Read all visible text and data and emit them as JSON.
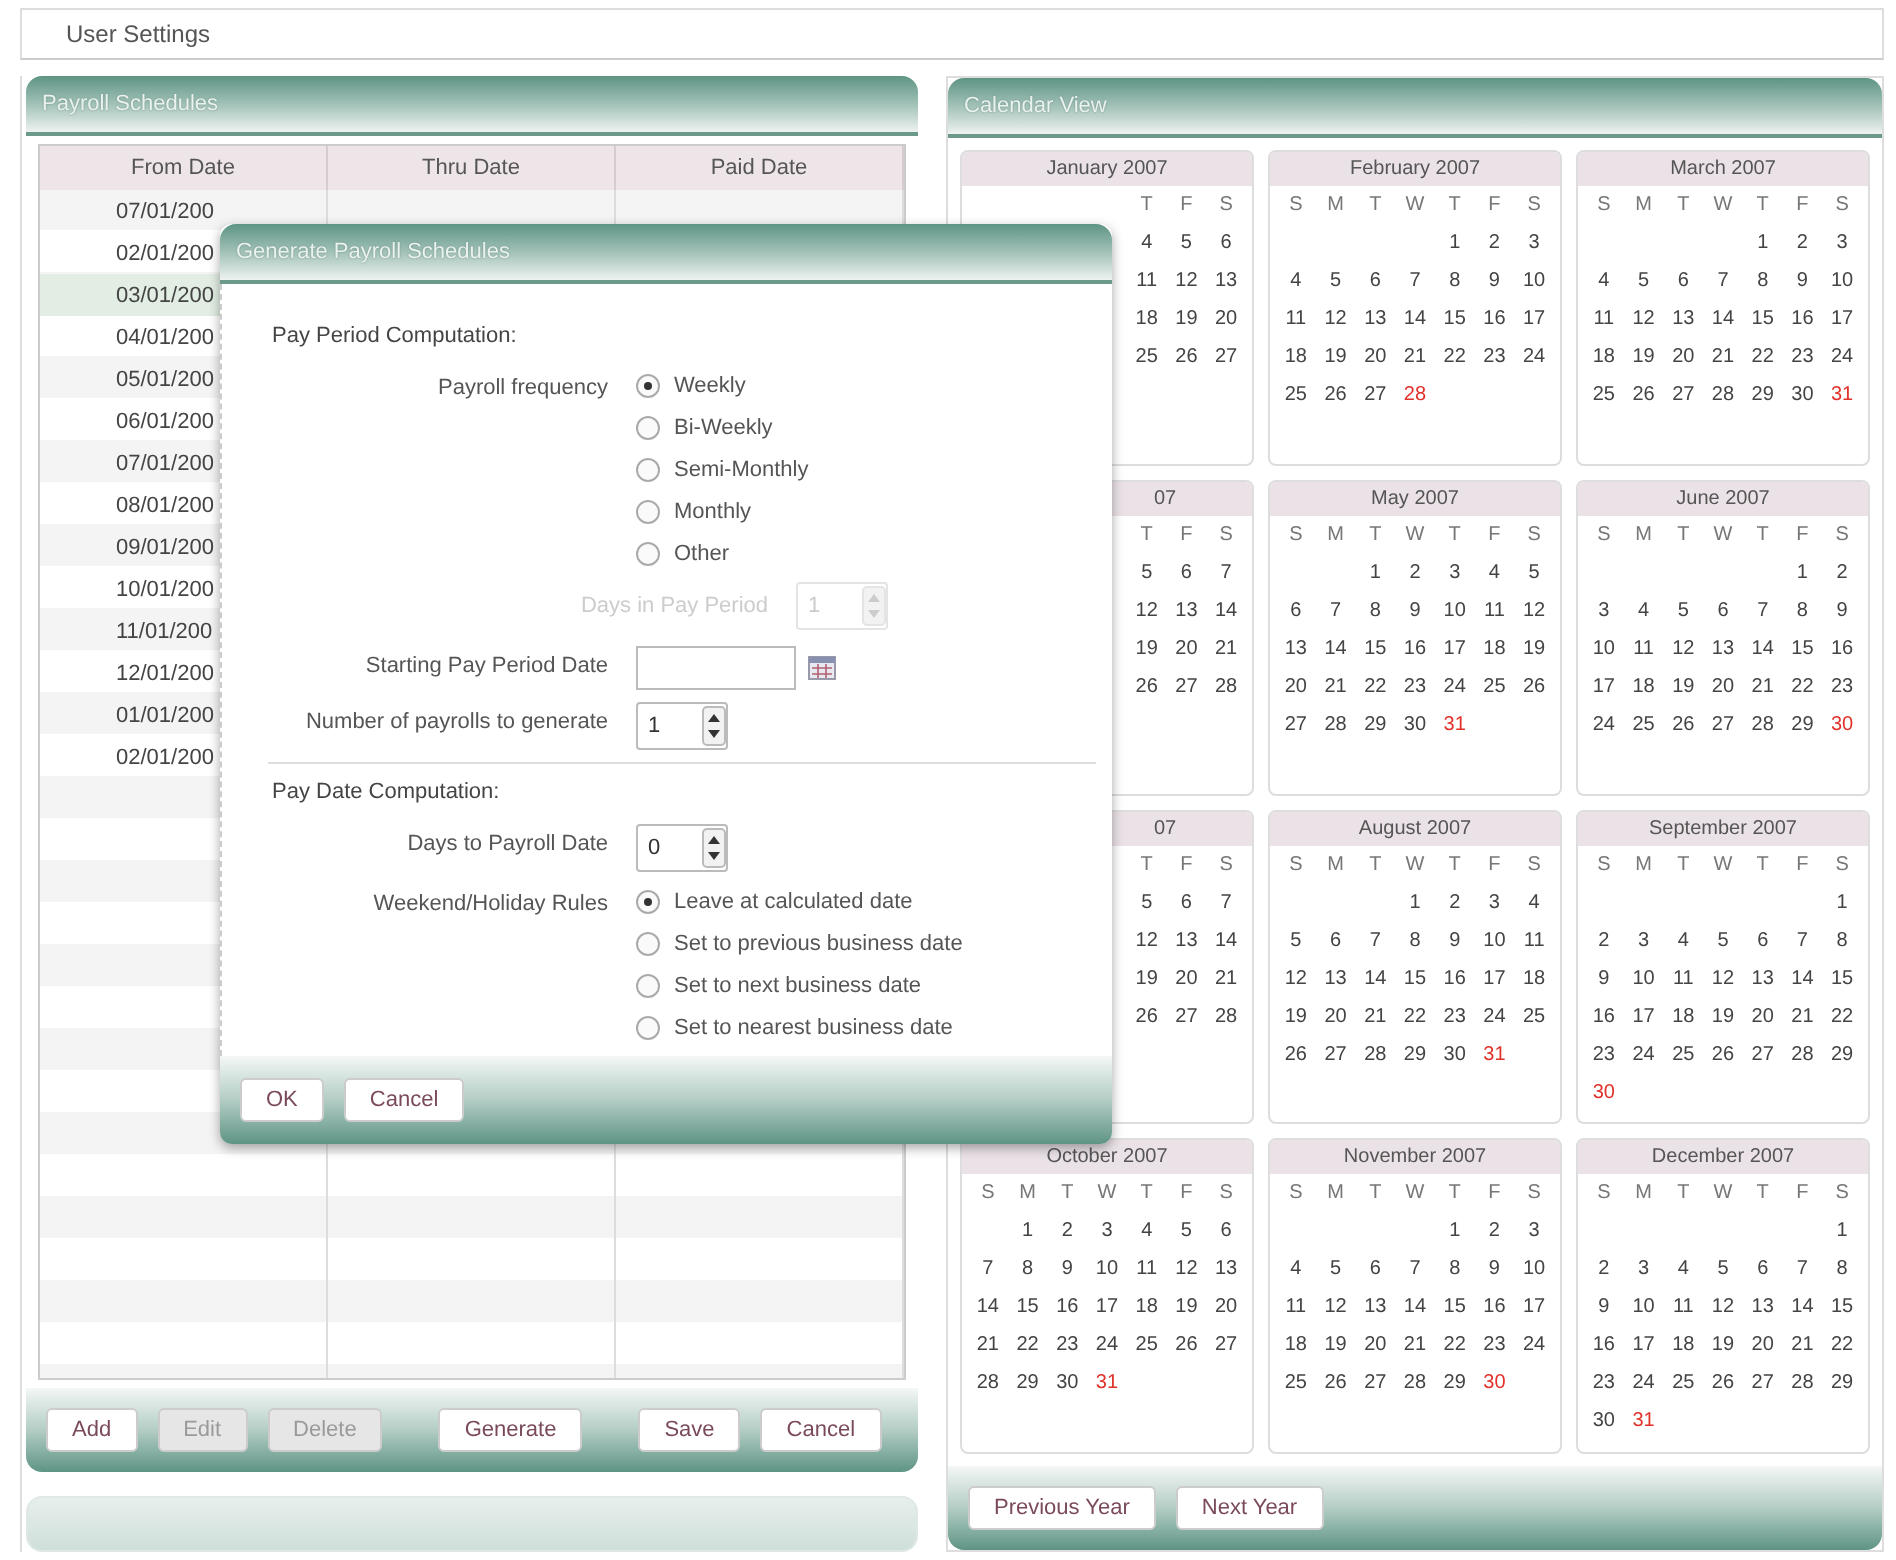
{
  "top_bar": {
    "title": "User Settings"
  },
  "payroll_panel": {
    "title": "Payroll Schedules",
    "columns": [
      "From Date",
      "Thru Date",
      "Paid Date"
    ],
    "rows": [
      {
        "from_date": "07/01/200",
        "selected": false
      },
      {
        "from_date": "02/01/200",
        "selected": false
      },
      {
        "from_date": "03/01/200",
        "selected": true
      },
      {
        "from_date": "04/01/200",
        "selected": false
      },
      {
        "from_date": "05/01/200",
        "selected": false
      },
      {
        "from_date": "06/01/200",
        "selected": false
      },
      {
        "from_date": "07/01/200",
        "selected": false
      },
      {
        "from_date": "08/01/200",
        "selected": false
      },
      {
        "from_date": "09/01/200",
        "selected": false
      },
      {
        "from_date": "10/01/200",
        "selected": false
      },
      {
        "from_date": "11/01/200",
        "selected": false
      },
      {
        "from_date": "12/01/200",
        "selected": false
      },
      {
        "from_date": "01/01/200",
        "selected": false
      },
      {
        "from_date": "02/01/200",
        "selected": false
      }
    ],
    "buttons": [
      {
        "label": "Add",
        "disabled": false
      },
      {
        "label": "Edit",
        "disabled": true
      },
      {
        "label": "Delete",
        "disabled": true
      },
      {
        "label": "Generate",
        "disabled": false
      },
      {
        "label": "Save",
        "disabled": false
      },
      {
        "label": "Cancel",
        "disabled": false
      }
    ]
  },
  "calendar_panel": {
    "title": "Calendar View",
    "months": [
      {
        "title": "January 2007",
        "title_cut": false,
        "kind": "covered",
        "weekdays": [
          "T",
          "F",
          "S"
        ],
        "weeks": [
          {
            "kind": "leading",
            "days": [
              "4",
              "5",
              "6"
            ]
          },
          {
            "kind": "leading",
            "days": [
              "11",
              "12",
              "13"
            ]
          },
          {
            "kind": "leading",
            "days": [
              "18",
              "19",
              "20"
            ]
          },
          {
            "kind": "leading",
            "days": [
              "25",
              "26",
              "27"
            ]
          }
        ]
      },
      {
        "title": "February 2007",
        "title_cut": false,
        "kind": "whole",
        "weekdays": [
          "S",
          "M",
          "T",
          "W",
          "T",
          "F",
          "S"
        ],
        "weeks": [
          {
            "kind": "leading",
            "days": [
              "1",
              "2",
              "3"
            ]
          },
          {
            "kind": "trailing",
            "days": [
              "4",
              "5",
              "6",
              "7",
              "8",
              "9",
              "10"
            ]
          },
          {
            "kind": "trailing",
            "days": [
              "11",
              "12",
              "13",
              "14",
              "15",
              "16",
              "17"
            ]
          },
          {
            "kind": "trailing",
            "days": [
              "18",
              "19",
              "20",
              "21",
              "22",
              "23",
              "24"
            ]
          },
          {
            "kind": "trailing",
            "days": [
              "25",
              "26",
              "27",
              {
                "text": "28",
                "highlighted": true
              }
            ]
          }
        ]
      },
      {
        "title": "March 2007",
        "title_cut": false,
        "kind": "whole",
        "weekdays": [
          "S",
          "M",
          "T",
          "W",
          "T",
          "F",
          "S"
        ],
        "weeks": [
          {
            "kind": "leading",
            "days": [
              "1",
              "2",
              "3"
            ]
          },
          {
            "kind": "trailing",
            "days": [
              "4",
              "5",
              "6",
              "7",
              "8",
              "9",
              "10"
            ]
          },
          {
            "kind": "trailing",
            "days": [
              "11",
              "12",
              "13",
              "14",
              "15",
              "16",
              "17"
            ]
          },
          {
            "kind": "trailing",
            "days": [
              "18",
              "19",
              "20",
              "21",
              "22",
              "23",
              "24"
            ]
          },
          {
            "kind": "trailing",
            "days": [
              "25",
              "26",
              "27",
              "28",
              "29",
              "30",
              {
                "text": "31",
                "highlighted": true
              }
            ]
          }
        ]
      },
      {
        "title": "07",
        "title_cut": true,
        "kind": "covered",
        "weekdays": [
          "T",
          "F",
          "S"
        ],
        "weeks": [
          {
            "kind": "leading",
            "days": [
              "5",
              "6",
              "7"
            ]
          },
          {
            "kind": "leading",
            "days": [
              "12",
              "13",
              "14"
            ]
          },
          {
            "kind": "leading",
            "days": [
              "19",
              "20",
              "21"
            ]
          },
          {
            "kind": "leading",
            "days": [
              "26",
              "27",
              "28"
            ]
          }
        ]
      },
      {
        "title": "May 2007",
        "title_cut": false,
        "kind": "whole",
        "weekdays": [
          "S",
          "M",
          "T",
          "W",
          "T",
          "F",
          "S"
        ],
        "weeks": [
          {
            "kind": "leading",
            "days": [
              "1",
              "2",
              "3",
              "4",
              "5"
            ]
          },
          {
            "kind": "trailing",
            "days": [
              "6",
              "7",
              "8",
              "9",
              "10",
              "11",
              "12"
            ]
          },
          {
            "kind": "trailing",
            "days": [
              "13",
              "14",
              "15",
              "16",
              "17",
              "18",
              "19"
            ]
          },
          {
            "kind": "trailing",
            "days": [
              "20",
              "21",
              "22",
              "23",
              "24",
              "25",
              "26"
            ]
          },
          {
            "kind": "trailing",
            "days": [
              "27",
              "28",
              "29",
              "30",
              {
                "text": "31",
                "highlighted": true
              }
            ]
          }
        ]
      },
      {
        "title": "June 2007",
        "title_cut": false,
        "kind": "whole",
        "weekdays": [
          "S",
          "M",
          "T",
          "W",
          "T",
          "F",
          "S"
        ],
        "weeks": [
          {
            "kind": "leading",
            "days": [
              "1",
              "2"
            ]
          },
          {
            "kind": "trailing",
            "days": [
              "3",
              "4",
              "5",
              "6",
              "7",
              "8",
              "9"
            ]
          },
          {
            "kind": "trailing",
            "days": [
              "10",
              "11",
              "12",
              "13",
              "14",
              "15",
              "16"
            ]
          },
          {
            "kind": "trailing",
            "days": [
              "17",
              "18",
              "19",
              "20",
              "21",
              "22",
              "23"
            ]
          },
          {
            "kind": "trailing",
            "days": [
              "24",
              "25",
              "26",
              "27",
              "28",
              "29",
              {
                "text": "30",
                "highlighted": true
              }
            ]
          }
        ]
      },
      {
        "title": "07",
        "title_cut": true,
        "kind": "covered",
        "weekdays": [
          "T",
          "F",
          "S"
        ],
        "weeks": [
          {
            "kind": "leading",
            "days": [
              "5",
              "6",
              "7"
            ]
          },
          {
            "kind": "leading",
            "days": [
              "12",
              "13",
              "14"
            ]
          },
          {
            "kind": "leading",
            "days": [
              "19",
              "20",
              "21"
            ]
          },
          {
            "kind": "leading",
            "days": [
              "26",
              "27",
              "28"
            ]
          }
        ]
      },
      {
        "title": "August 2007",
        "title_cut": false,
        "kind": "whole",
        "weekdays": [
          "S",
          "M",
          "T",
          "W",
          "T",
          "F",
          "S"
        ],
        "weeks": [
          {
            "kind": "leading",
            "days": [
              "1",
              "2",
              "3",
              "4"
            ]
          },
          {
            "kind": "trailing",
            "days": [
              "5",
              "6",
              "7",
              "8",
              "9",
              "10",
              "11"
            ]
          },
          {
            "kind": "trailing",
            "days": [
              "12",
              "13",
              "14",
              "15",
              "16",
              "17",
              "18"
            ]
          },
          {
            "kind": "trailing",
            "days": [
              "19",
              "20",
              "21",
              "22",
              "23",
              "24",
              "25"
            ]
          },
          {
            "kind": "trailing",
            "days": [
              "26",
              "27",
              "28",
              "29",
              "30",
              {
                "text": "31",
                "highlighted": true
              }
            ]
          }
        ]
      },
      {
        "title": "September 2007",
        "title_cut": false,
        "kind": "whole",
        "weekdays": [
          "S",
          "M",
          "T",
          "W",
          "T",
          "F",
          "S"
        ],
        "weeks": [
          {
            "kind": "leading",
            "days": [
              "1"
            ]
          },
          {
            "kind": "trailing",
            "days": [
              "2",
              "3",
              "4",
              "5",
              "6",
              "7",
              "8"
            ]
          },
          {
            "kind": "trailing",
            "days": [
              "9",
              "10",
              "11",
              "12",
              "13",
              "14",
              "15"
            ]
          },
          {
            "kind": "trailing",
            "days": [
              "16",
              "17",
              "18",
              "19",
              "20",
              "21",
              "22"
            ]
          },
          {
            "kind": "trailing",
            "days": [
              "23",
              "24",
              "25",
              "26",
              "27",
              "28",
              "29"
            ]
          },
          {
            "kind": "trailing",
            "days": [
              {
                "text": "30",
                "highlighted": true
              }
            ]
          }
        ]
      },
      {
        "title": "October 2007",
        "title_cut": false,
        "kind": "whole",
        "weekdays": [
          "S",
          "M",
          "T",
          "W",
          "T",
          "F",
          "S"
        ],
        "weeks": [
          {
            "kind": "leading",
            "days": [
              "1",
              "2",
              "3",
              "4",
              "5",
              "6"
            ]
          },
          {
            "kind": "trailing",
            "days": [
              "7",
              "8",
              "9",
              "10",
              "11",
              "12",
              "13"
            ]
          },
          {
            "kind": "trailing",
            "days": [
              "14",
              "15",
              "16",
              "17",
              "18",
              "19",
              "20"
            ]
          },
          {
            "kind": "trailing",
            "days": [
              "21",
              "22",
              "23",
              "24",
              "25",
              "26",
              "27"
            ]
          },
          {
            "kind": "trailing",
            "days": [
              "28",
              "29",
              "30",
              {
                "text": "31",
                "highlighted": true
              }
            ]
          }
        ]
      },
      {
        "title": "November 2007",
        "title_cut": false,
        "kind": "whole",
        "weekdays": [
          "S",
          "M",
          "T",
          "W",
          "T",
          "F",
          "S"
        ],
        "weeks": [
          {
            "kind": "leading",
            "days": [
              "1",
              "2",
              "3"
            ]
          },
          {
            "kind": "trailing",
            "days": [
              "4",
              "5",
              "6",
              "7",
              "8",
              "9",
              "10"
            ]
          },
          {
            "kind": "trailing",
            "days": [
              "11",
              "12",
              "13",
              "14",
              "15",
              "16",
              "17"
            ]
          },
          {
            "kind": "trailing",
            "days": [
              "18",
              "19",
              "20",
              "21",
              "22",
              "23",
              "24"
            ]
          },
          {
            "kind": "trailing",
            "days": [
              "25",
              "26",
              "27",
              "28",
              "29",
              {
                "text": "30",
                "highlighted": true
              }
            ]
          }
        ]
      },
      {
        "title": "December 2007",
        "title_cut": false,
        "kind": "whole",
        "weekdays": [
          "S",
          "M",
          "T",
          "W",
          "T",
          "F",
          "S"
        ],
        "weeks": [
          {
            "kind": "leading",
            "days": [
              "1"
            ]
          },
          {
            "kind": "trailing",
            "days": [
              "2",
              "3",
              "4",
              "5",
              "6",
              "7",
              "8"
            ]
          },
          {
            "kind": "trailing",
            "days": [
              "9",
              "10",
              "11",
              "12",
              "13",
              "14",
              "15"
            ]
          },
          {
            "kind": "trailing",
            "days": [
              "16",
              "17",
              "18",
              "19",
              "20",
              "21",
              "22"
            ]
          },
          {
            "kind": "trailing",
            "days": [
              "23",
              "24",
              "25",
              "26",
              "27",
              "28",
              "29"
            ]
          },
          {
            "kind": "trailing",
            "days": [
              "30",
              {
                "text": "31",
                "highlighted": true
              }
            ]
          }
        ]
      }
    ],
    "buttons": [
      "Previous Year",
      "Next Year"
    ]
  },
  "dialog": {
    "title": "Generate Payroll Schedules",
    "pay_period": {
      "heading": "Pay Period Computation:",
      "frequency": {
        "label": "Payroll frequency",
        "options": [
          {
            "label": "Weekly",
            "selected": true
          },
          {
            "label": "Bi-Weekly",
            "selected": false
          },
          {
            "label": "Semi-Monthly",
            "selected": false
          },
          {
            "label": "Monthly",
            "selected": false
          },
          {
            "label": "Other",
            "selected": false
          }
        ]
      },
      "days_in_period": {
        "label": "Days in Pay Period",
        "value": "1",
        "disabled": true
      },
      "start_date": {
        "label": "Starting Pay Period Date"
      },
      "payroll_count": {
        "label": "Number of payrolls to generate",
        "value": "1",
        "disabled": false
      }
    },
    "pay_date": {
      "heading": "Pay Date Computation:",
      "days_to_payroll": {
        "label": "Days to Payroll Date",
        "value": "0",
        "disabled": false
      },
      "rules": {
        "label": "Weekend/Holiday Rules",
        "options": [
          {
            "label": "Leave at calculated date",
            "selected": true
          },
          {
            "label": "Set to previous business date",
            "selected": false
          },
          {
            "label": "Set to next business date",
            "selected": false
          },
          {
            "label": "Set to nearest business date",
            "selected": false
          }
        ]
      }
    },
    "buttons": [
      "OK",
      "Cancel"
    ]
  }
}
